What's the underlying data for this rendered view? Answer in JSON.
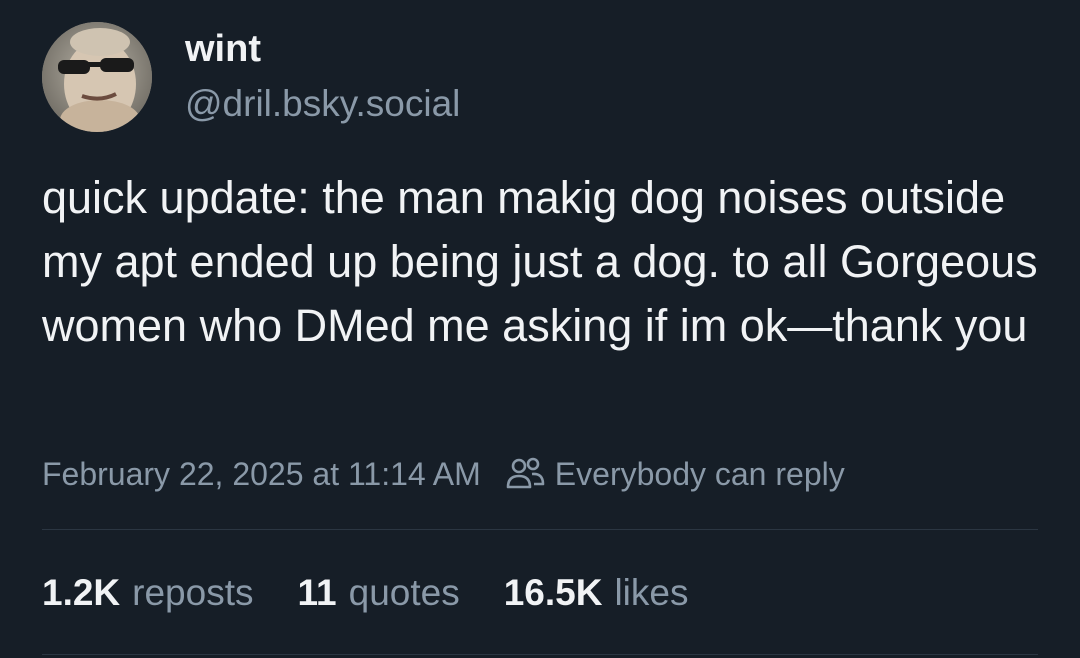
{
  "author": {
    "display_name": "wint",
    "handle": "@dril.bsky.social",
    "avatar_icon": "user-avatar"
  },
  "post": {
    "text": "quick update: the man makig dog noises outside my apt ended up being just a dog. to all Gorgeous women who DMed me asking if im ok—thank you",
    "timestamp": "February 22, 2025 at 11:14 AM",
    "reply_setting": "Everybody can reply",
    "reply_icon": "people-icon"
  },
  "stats": {
    "reposts_count": "1.2K",
    "reposts_label": "reposts",
    "quotes_count": "11",
    "quotes_label": "quotes",
    "likes_count": "16.5K",
    "likes_label": "likes"
  },
  "colors": {
    "background": "#161e27",
    "text": "#f1f3f5",
    "muted": "#8a99a8",
    "divider": "#2b3642"
  }
}
